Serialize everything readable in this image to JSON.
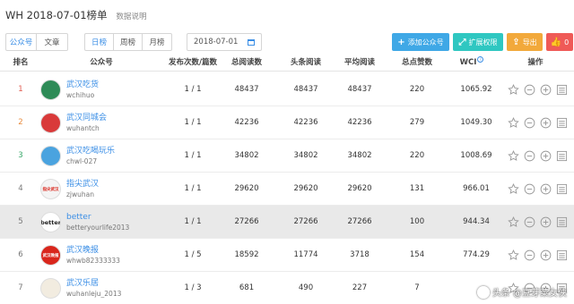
{
  "header": {
    "title": "WH 2018-07-01榜单",
    "subtitle": "数据说明"
  },
  "toolbar": {
    "type_tabs": [
      "公众号",
      "文章"
    ],
    "period_tabs": [
      "日榜",
      "周榜",
      "月榜"
    ],
    "date": "2018-07-01",
    "add_label": "添加公众号",
    "perm_label": "扩展权限",
    "export_label": "导出",
    "like_label": "0",
    "colors": {
      "add": "#3fa8e6",
      "perm": "#2fc7c1",
      "export": "#f2a93b",
      "like": "#ef5a57",
      "link": "#3a8ee6"
    }
  },
  "table": {
    "columns": [
      "排名",
      "公众号",
      "发布次数/篇数",
      "总阅读数",
      "头条阅读",
      "平均阅读",
      "总点赞数",
      "WCI",
      "操作"
    ],
    "rows": [
      {
        "rank": "1",
        "name": "武汉吃货",
        "id": "wchihuo",
        "posts": "1 / 1",
        "total_reads": "48437",
        "headline_reads": "48437",
        "avg_reads": "48437",
        "likes": "220",
        "wci": "1065.92",
        "rank_color": "#e05a4e",
        "avatar": {
          "text": "",
          "color": "#2e8b57",
          "icon": "foodie-avatar"
        }
      },
      {
        "rank": "2",
        "name": "武汉同城会",
        "id": "wuhantch",
        "posts": "1 / 1",
        "total_reads": "42236",
        "headline_reads": "42236",
        "avg_reads": "42236",
        "likes": "279",
        "wci": "1049.30",
        "rank_color": "#e88a3c",
        "avatar": {
          "text": "",
          "color": "#d93a3a",
          "icon": "city-club-avatar"
        }
      },
      {
        "rank": "3",
        "name": "武汉吃喝玩乐",
        "id": "chwl-027",
        "posts": "1 / 1",
        "total_reads": "34802",
        "headline_reads": "34802",
        "avg_reads": "34802",
        "likes": "220",
        "wci": "1008.69",
        "rank_color": "#3aa86b",
        "avatar": {
          "text": "",
          "color": "#4aa3df",
          "icon": "fun-avatar"
        }
      },
      {
        "rank": "4",
        "name": "指尖武汉",
        "id": "zjwuhan",
        "posts": "1 / 1",
        "total_reads": "29620",
        "headline_reads": "29620",
        "avg_reads": "29620",
        "likes": "131",
        "wci": "966.01",
        "rank_color": "#777777",
        "avatar": {
          "text": "指尖武汉",
          "color": "#f4f4f4",
          "icon": "fingertip-avatar"
        }
      },
      {
        "rank": "5",
        "name": "better",
        "id": "betteryourlife2013",
        "posts": "1 / 1",
        "total_reads": "27266",
        "headline_reads": "27266",
        "avg_reads": "27266",
        "likes": "100",
        "wci": "944.34",
        "rank_color": "#777777",
        "avatar": {
          "text": "better",
          "color": "#ffffff",
          "icon": "better-avatar"
        }
      },
      {
        "rank": "6",
        "name": "武汉晚报",
        "id": "whwb82333333",
        "posts": "1 / 5",
        "total_reads": "18592",
        "headline_reads": "11774",
        "avg_reads": "3718",
        "likes": "154",
        "wci": "774.29",
        "rank_color": "#777777",
        "avatar": {
          "text": "武汉晚报",
          "color": "#d9261c",
          "icon": "evening-news-avatar"
        }
      },
      {
        "rank": "7",
        "name": "武汉乐居",
        "id": "wuhanleju_2013",
        "posts": "1 / 3",
        "total_reads": "681",
        "headline_reads": "490",
        "avg_reads": "227",
        "likes": "7",
        "wci": "",
        "rank_color": "#777777",
        "avatar": {
          "text": "",
          "color": "#f2ece0",
          "icon": "leju-avatar"
        }
      }
    ]
  },
  "watermark": "头条 @豆芽菜女侠"
}
